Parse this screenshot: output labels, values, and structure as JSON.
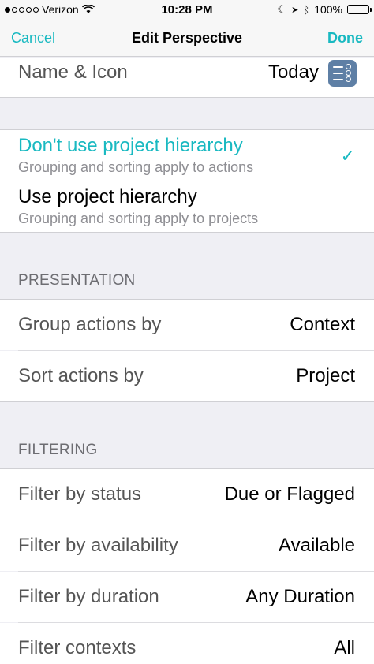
{
  "status_bar": {
    "carrier": "Verizon",
    "time": "10:28 PM",
    "battery": "100%",
    "signal_icon": "signal-dots-icon",
    "wifi_icon": "wifi-icon"
  },
  "nav": {
    "cancel": "Cancel",
    "title": "Edit Perspective",
    "done": "Done"
  },
  "name_row": {
    "label": "Name & Icon",
    "value": "Today",
    "icon": "perspective-list-icon"
  },
  "hierarchy_options": [
    {
      "title": "Don't use project hierarchy",
      "subtitle": "Grouping and sorting apply to actions",
      "selected": true
    },
    {
      "title": "Use project hierarchy",
      "subtitle": "Grouping and sorting apply to projects",
      "selected": false
    }
  ],
  "presentation": {
    "header": "PRESENTATION",
    "rows": [
      {
        "label": "Group actions by",
        "value": "Context"
      },
      {
        "label": "Sort actions by",
        "value": "Project"
      }
    ]
  },
  "filtering": {
    "header": "FILTERING",
    "rows": [
      {
        "label": "Filter by status",
        "value": "Due or Flagged"
      },
      {
        "label": "Filter by availability",
        "value": "Available"
      },
      {
        "label": "Filter by duration",
        "value": "Any Duration"
      },
      {
        "label": "Filter contexts",
        "value": "All"
      }
    ]
  },
  "colors": {
    "accent": "#19b9c1",
    "icon_bg": "#5e7fa5",
    "group_bg": "#efeff4"
  }
}
